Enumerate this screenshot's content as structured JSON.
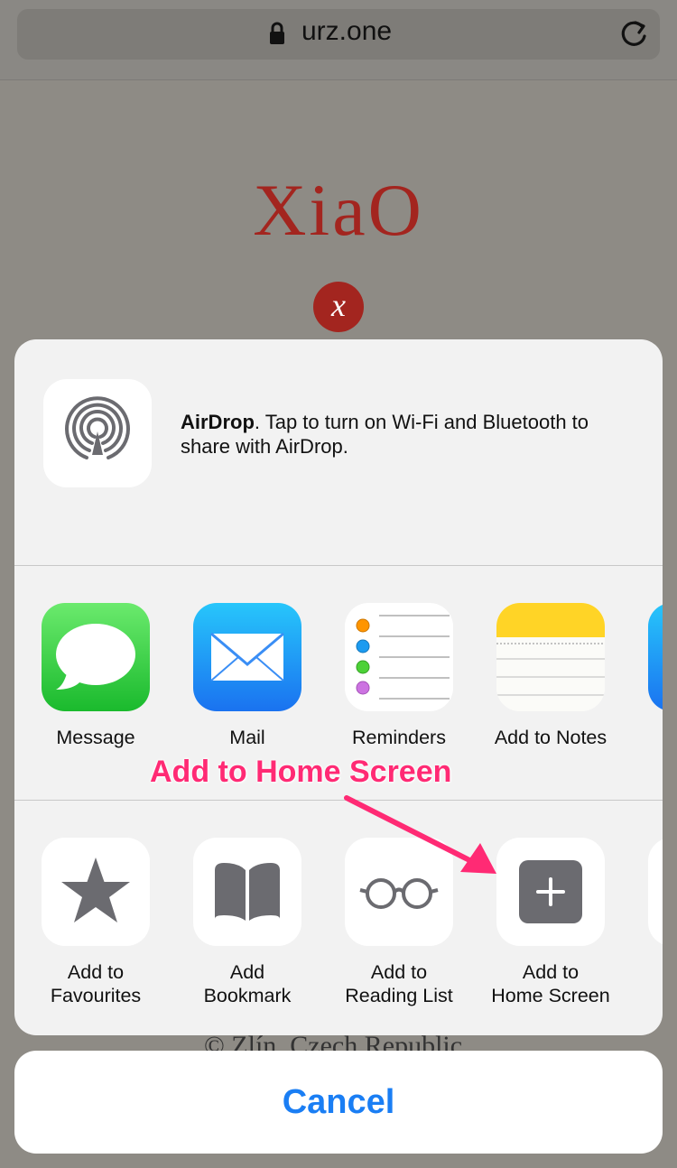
{
  "browser": {
    "url": "urz.one"
  },
  "website": {
    "title": "XiaO",
    "logo_letter": "x",
    "footer": "© Zlín, Czech Republic"
  },
  "airdrop": {
    "name": "AirDrop",
    "message": ". Tap to turn on Wi-Fi and Bluetooth to share with AirDrop."
  },
  "share_apps": [
    {
      "label": "Message",
      "icon": "message-icon"
    },
    {
      "label": "Mail",
      "icon": "mail-icon"
    },
    {
      "label": "Reminders",
      "icon": "reminders-icon"
    },
    {
      "label": "Add to Notes",
      "icon": "notes-icon"
    }
  ],
  "actions": [
    {
      "line1": "Add to",
      "line2": "Favourites",
      "icon": "star-icon"
    },
    {
      "line1": "Add",
      "line2": "Bookmark",
      "icon": "book-icon"
    },
    {
      "line1": "Add to",
      "line2": "Reading List",
      "icon": "glasses-icon"
    },
    {
      "line1": "Add to",
      "line2": "Home Screen",
      "icon": "plus-square-icon"
    }
  ],
  "annotation": {
    "text": "Add to Home Screen",
    "color": "#ff2a74"
  },
  "cancel_label": "Cancel",
  "colors": {
    "accent": "#1a7ef4",
    "brand": "#a3251f"
  }
}
